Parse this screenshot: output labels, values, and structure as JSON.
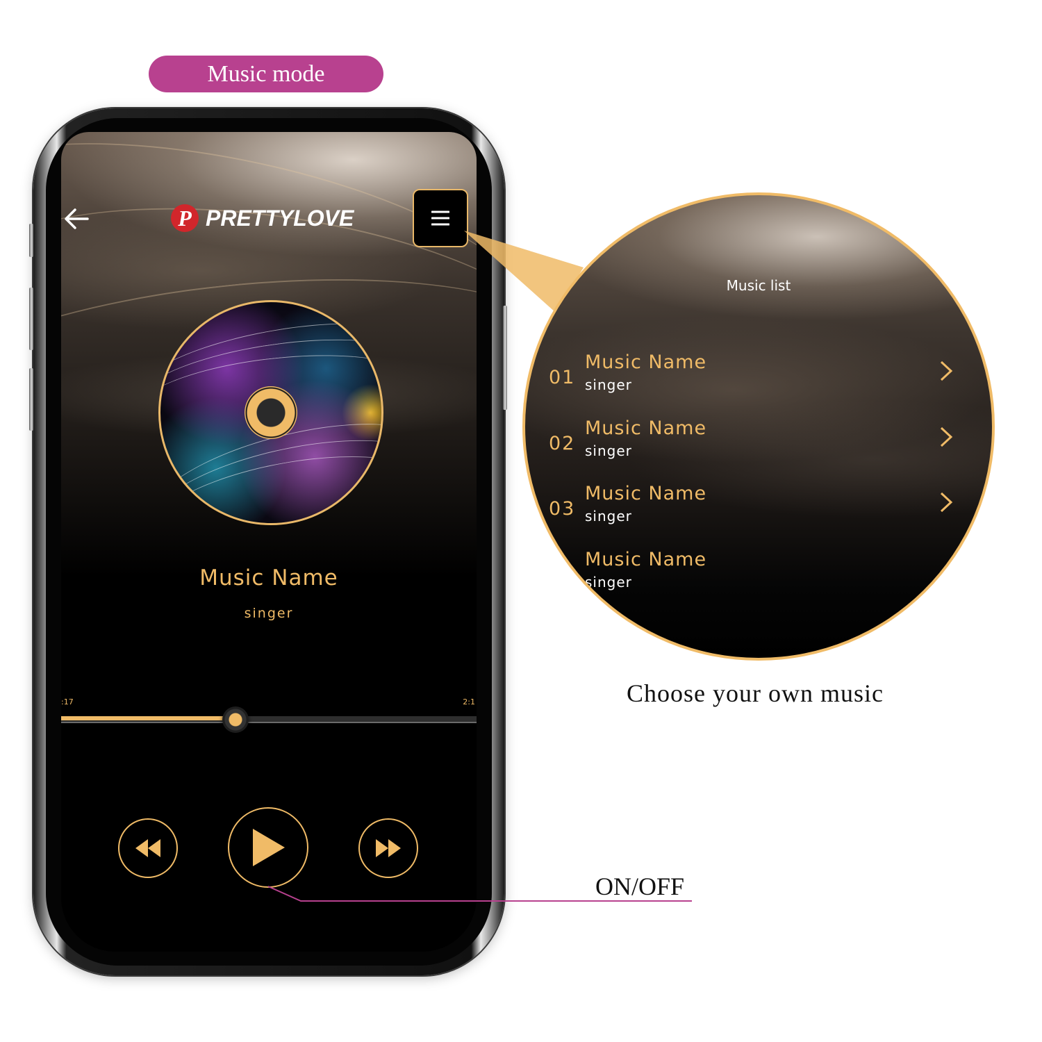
{
  "header_label": "Music mode",
  "app": {
    "brand_initial": "P",
    "brand_name": "PRETTYLOVE",
    "icons": {
      "back": "arrow-left-icon",
      "menu": "hamburger-menu-icon"
    }
  },
  "player": {
    "now_playing": {
      "title": "Music Name",
      "singer": "singer"
    },
    "elapsed_time": ":17",
    "total_time": "2:1",
    "progress_percent": 42,
    "controls": {
      "rewind": "rewind-icon",
      "play": "play-icon",
      "fast_forward": "fast-forward-icon"
    }
  },
  "music_list": {
    "title": "Music list",
    "items": [
      {
        "number": "01",
        "name": "Music Name",
        "singer": "singer"
      },
      {
        "number": "02",
        "name": "Music Name",
        "singer": "singer"
      },
      {
        "number": "03",
        "name": "Music Name",
        "singer": "singer"
      },
      {
        "number": "",
        "name": "Music Name",
        "singer": "singer"
      }
    ]
  },
  "annotations": {
    "callout_caption": "Choose your own music",
    "play_label": "ON/OFF"
  },
  "colors": {
    "accent_gold": "#f0bb67",
    "pill_magenta": "#b8418f",
    "leader_line": "#b8418f",
    "brand_red": "#d1262b"
  }
}
